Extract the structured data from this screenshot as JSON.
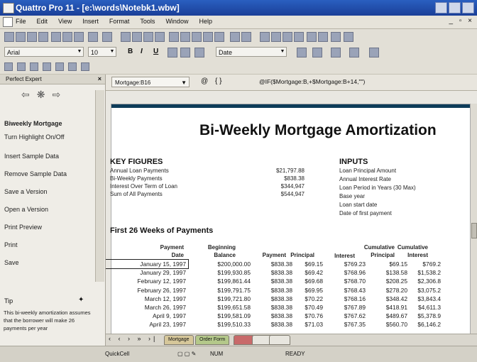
{
  "window": {
    "title": "Quattro Pro 11 - [e:\\words\\Notebk1.wbw]"
  },
  "menu": [
    "File",
    "Edit",
    "View",
    "Insert",
    "Format",
    "Tools",
    "Window",
    "Help"
  ],
  "toolbar": {
    "font_name": "Arial",
    "font_size": "10",
    "bold_label": "B",
    "italic_label": "I",
    "underline_label": "U",
    "number_format": "Date"
  },
  "left_panel": {
    "title": "Perfect Expert",
    "close_label": "×",
    "items": [
      "Biweekly Mortgage",
      "Turn Highlight On/Off",
      "Insert Sample Data",
      "Remove Sample Data",
      "Save a Version",
      "Open a Version",
      "Print Preview",
      "Print",
      "Save"
    ],
    "tip_label": "Tip",
    "tip_text": "This bi-weekly amortization assumes that the borrower will make 26 payments per year"
  },
  "formula_bar": {
    "cell_name": "Mortgage:B16",
    "formula": "@IF($Mortgage:B,+$Mortgage:B+14,\"\")"
  },
  "sheet": {
    "title": "Bi-Weekly Mortgage Amortization",
    "key_figures": {
      "heading": "KEY FIGURES",
      "rows": [
        {
          "label": "Annual Loan Payments",
          "value": "$21,797.88"
        },
        {
          "label": "Bi-Weekly Payments",
          "value": "$838.38"
        },
        {
          "label": "Interest Over Term of Loan",
          "value": "$344,947"
        },
        {
          "label": "Sum of All Payments",
          "value": "$544,947"
        }
      ]
    },
    "inputs": {
      "heading": "INPUTS",
      "rows": [
        "Loan Principal Amount",
        "Annual Interest Rate",
        "Loan Period in Years (30 Max)",
        "Base year",
        "Loan start date",
        "Date of first payment"
      ]
    },
    "weeks_heading": "First 26 Weeks of Payments",
    "table_headers": {
      "payment_date_1": "Payment",
      "payment_date_2": "Date",
      "balance_1": "Beginning",
      "balance_2": "Balance",
      "payment": "Payment",
      "principal": "Principal",
      "interest": "Interest",
      "cum_principal_1": "Cumulative",
      "cum_principal_2": "Principal",
      "cum_interest_1": "Cumulative",
      "cum_interest_2": "Interest"
    },
    "table_rows": [
      {
        "date": "January 15, 1997",
        "balance": "$200,000.00",
        "payment": "$838.38",
        "principal": "$69.15",
        "interest": "$769.23",
        "cum_principal": "$69.15",
        "cum_interest": "$769.2"
      },
      {
        "date": "January 29, 1997",
        "balance": "$199,930.85",
        "payment": "$838.38",
        "principal": "$69.42",
        "interest": "$768.96",
        "cum_principal": "$138.58",
        "cum_interest": "$1,538.2"
      },
      {
        "date": "February 12, 1997",
        "balance": "$199,861.44",
        "payment": "$838.38",
        "principal": "$69.68",
        "interest": "$768.70",
        "cum_principal": "$208.25",
        "cum_interest": "$2,306.8"
      },
      {
        "date": "February 26, 1997",
        "balance": "$199,791.75",
        "payment": "$838.38",
        "principal": "$69.95",
        "interest": "$768.43",
        "cum_principal": "$278.20",
        "cum_interest": "$3,075.2"
      },
      {
        "date": "March 12, 1997",
        "balance": "$199,721.80",
        "payment": "$838.38",
        "principal": "$70.22",
        "interest": "$768.16",
        "cum_principal": "$348.42",
        "cum_interest": "$3,843.4"
      },
      {
        "date": "March 26, 1997",
        "balance": "$199,651.58",
        "payment": "$838.38",
        "principal": "$70.49",
        "interest": "$767.89",
        "cum_principal": "$418.91",
        "cum_interest": "$4,611.3"
      },
      {
        "date": "April 9, 1997",
        "balance": "$199,581.09",
        "payment": "$838.38",
        "principal": "$70.76",
        "interest": "$767.62",
        "cum_principal": "$489.67",
        "cum_interest": "$5,378.9"
      },
      {
        "date": "April 23, 1997",
        "balance": "$199,510.33",
        "payment": "$838.38",
        "principal": "$71.03",
        "interest": "$767.35",
        "cum_principal": "$560.70",
        "cum_interest": "$6,146.2"
      }
    ]
  },
  "sheet_tabs": [
    "Mortgage",
    "Order Form"
  ],
  "status_bar": {
    "quickcell": "QuickCell",
    "num": "NUM",
    "ready": "READY"
  }
}
